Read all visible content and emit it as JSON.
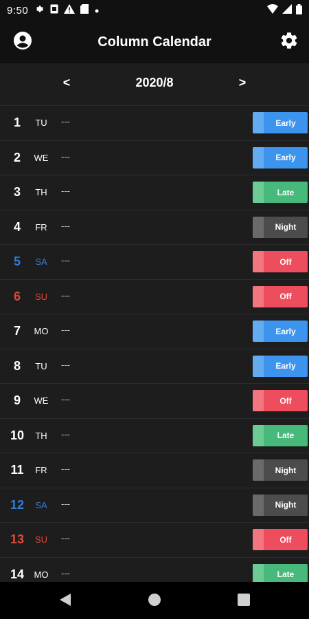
{
  "status_bar": {
    "time": "9:50",
    "icons": [
      "gear-icon",
      "sim-icon",
      "warning-icon",
      "sd-card-icon",
      "dot-icon"
    ],
    "right_icons": [
      "wifi-icon",
      "signal-icon",
      "battery-icon"
    ]
  },
  "app_bar": {
    "title": "Column Calendar",
    "left_icon": "account-circle-icon",
    "right_icon": "gear-icon"
  },
  "month_nav": {
    "prev": "<",
    "label": "2020/8",
    "next": ">"
  },
  "colors": {
    "early": "#3d94ee",
    "early_tab": "#64acf2",
    "late": "#47b97a",
    "late_tab": "#6ccb94",
    "night": "#4c4c4c",
    "night_tab": "#6a6a6a",
    "off": "#ee4d5e",
    "off_tab": "#f27580",
    "saturday": "#2f7fd6",
    "sunday": "#e2473c"
  },
  "days": [
    {
      "num": "1",
      "wd": "TU",
      "memo": "---",
      "shift": "Early",
      "kind": "early",
      "wk": "weekday"
    },
    {
      "num": "2",
      "wd": "WE",
      "memo": "---",
      "shift": "Early",
      "kind": "early",
      "wk": "weekday"
    },
    {
      "num": "3",
      "wd": "TH",
      "memo": "---",
      "shift": "Late",
      "kind": "late",
      "wk": "weekday"
    },
    {
      "num": "4",
      "wd": "FR",
      "memo": "---",
      "shift": "Night",
      "kind": "night",
      "wk": "weekday"
    },
    {
      "num": "5",
      "wd": "SA",
      "memo": "---",
      "shift": "Off",
      "kind": "off",
      "wk": "sat"
    },
    {
      "num": "6",
      "wd": "SU",
      "memo": "---",
      "shift": "Off",
      "kind": "off",
      "wk": "sun"
    },
    {
      "num": "7",
      "wd": "MO",
      "memo": "---",
      "shift": "Early",
      "kind": "early",
      "wk": "weekday"
    },
    {
      "num": "8",
      "wd": "TU",
      "memo": "---",
      "shift": "Early",
      "kind": "early",
      "wk": "weekday"
    },
    {
      "num": "9",
      "wd": "WE",
      "memo": "---",
      "shift": "Off",
      "kind": "off",
      "wk": "weekday"
    },
    {
      "num": "10",
      "wd": "TH",
      "memo": "---",
      "shift": "Late",
      "kind": "late",
      "wk": "weekday"
    },
    {
      "num": "11",
      "wd": "FR",
      "memo": "---",
      "shift": "Night",
      "kind": "night",
      "wk": "weekday"
    },
    {
      "num": "12",
      "wd": "SA",
      "memo": "---",
      "shift": "Night",
      "kind": "night",
      "wk": "sat"
    },
    {
      "num": "13",
      "wd": "SU",
      "memo": "---",
      "shift": "Off",
      "kind": "off",
      "wk": "sun"
    },
    {
      "num": "14",
      "wd": "MO",
      "memo": "---",
      "shift": "Late",
      "kind": "late",
      "wk": "weekday"
    }
  ],
  "nav_bar": {
    "icons": [
      "back-icon",
      "home-icon",
      "recents-icon"
    ]
  }
}
